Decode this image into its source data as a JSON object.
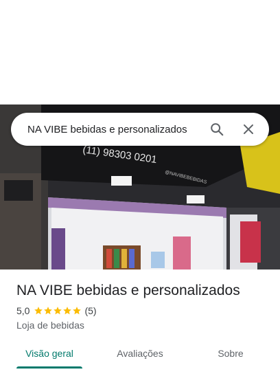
{
  "search": {
    "query": "NA VIBE bebidas e personalizados"
  },
  "photo": {
    "storefront_phone": "(11) 98303 0201",
    "storefront_handle": "@NAVIBEBEBIDAS"
  },
  "place": {
    "name": "NA VIBE bebidas e personalizados",
    "rating": "5,0",
    "stars": 5,
    "reviews": "(5)",
    "category": "Loja de bebidas"
  },
  "tabs": [
    {
      "label": "Visão geral",
      "selected": true
    },
    {
      "label": "Avaliações",
      "selected": false
    },
    {
      "label": "Sobre",
      "selected": false
    }
  ],
  "colors": {
    "accent": "#00796b",
    "star": "#fbbc04"
  }
}
